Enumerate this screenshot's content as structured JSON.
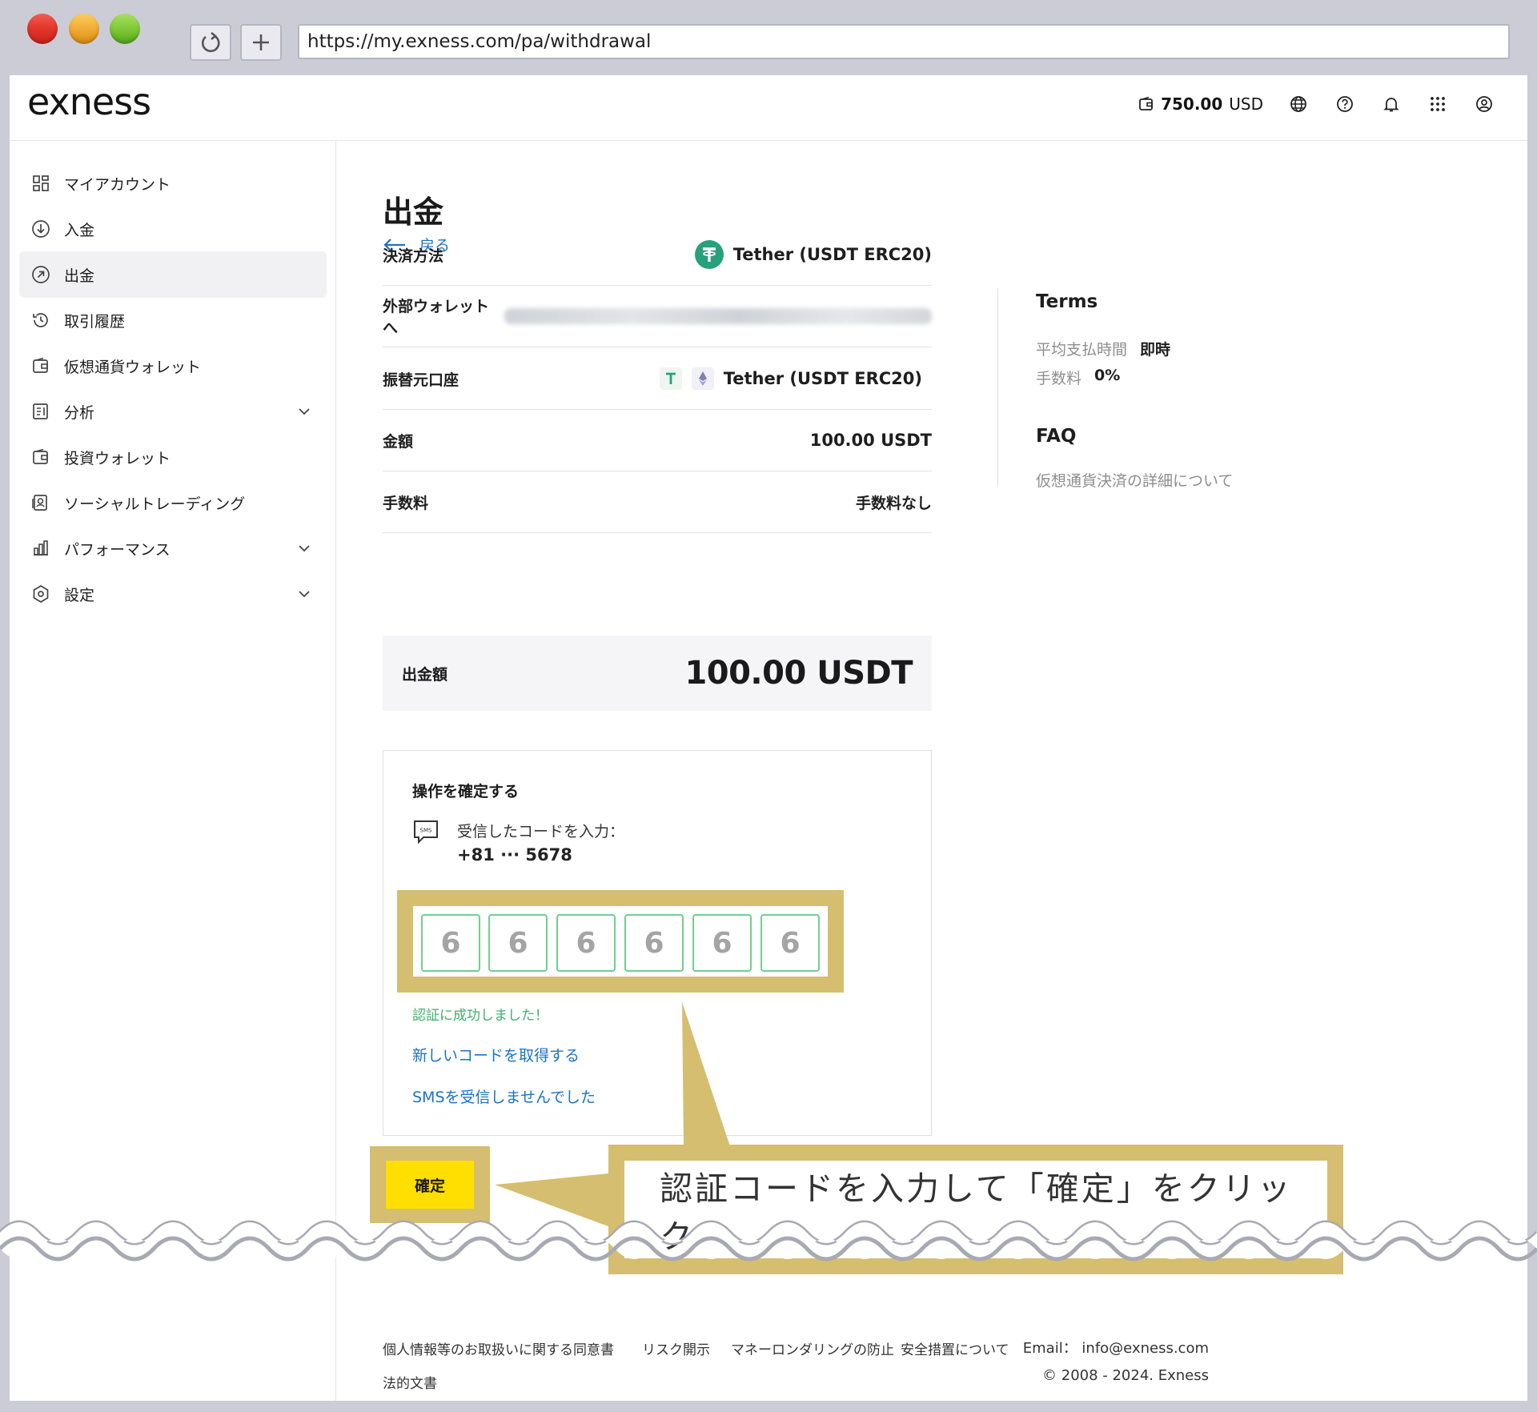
{
  "browser": {
    "url": "https://my.exness.com/pa/withdrawal"
  },
  "header": {
    "logo": "exness",
    "balance_amount": "750.00",
    "balance_currency": "USD"
  },
  "sidebar": {
    "items": [
      {
        "label": "マイアカウント",
        "icon": "dashboard-icon"
      },
      {
        "label": "入金",
        "icon": "deposit-icon"
      },
      {
        "label": "出金",
        "icon": "withdraw-icon",
        "active": true
      },
      {
        "label": "取引履歴",
        "icon": "history-icon"
      },
      {
        "label": "仮想通貨ウォレット",
        "icon": "wallet-icon"
      },
      {
        "label": "分析",
        "icon": "analytics-icon",
        "expandable": true
      },
      {
        "label": "投資ウォレット",
        "icon": "wallet-icon"
      },
      {
        "label": "ソーシャルトレーディング",
        "icon": "social-icon"
      },
      {
        "label": "パフォーマンス",
        "icon": "bar-chart-icon",
        "expandable": true
      },
      {
        "label": "設定",
        "icon": "settings-icon",
        "expandable": true
      }
    ]
  },
  "main": {
    "title": "出金",
    "back_label": "戻る",
    "rows": [
      {
        "label": "決済方法",
        "value": "Tether (USDT ERC20)"
      },
      {
        "label": "外部ウォレットへ",
        "value": ""
      },
      {
        "label": "振替元口座",
        "value": "Tether (USDT ERC20)"
      },
      {
        "label": "金額",
        "value": "100.00 USDT"
      },
      {
        "label": "手数料",
        "value": "手数料なし"
      }
    ],
    "total_label": "出金額",
    "total_amount": "100.00 USDT"
  },
  "confirm": {
    "title": "操作を確定する",
    "prompt": "受信したコードを入力：",
    "phone": "+81 ··· 5678",
    "code_digits": [
      "6",
      "6",
      "6",
      "6",
      "6",
      "6"
    ],
    "success": "認証に成功しました！",
    "new_code_link": "新しいコードを取得する",
    "no_sms_link": "SMSを受信しませんでした",
    "button_label": "確定"
  },
  "callout": {
    "text": "認証コードを入力して「確定」をクリック"
  },
  "side_panel": {
    "terms_title": "Terms",
    "avg_time_label": "平均支払時間",
    "avg_time_value": "即時",
    "fee_label": "手数料",
    "fee_value": "0%",
    "faq_title": "FAQ",
    "faq_link": "仮想通貨決済の詳細について"
  },
  "footer": {
    "links": [
      "個人情報等のお取扱いに関する同意書",
      "リスク開示",
      "マネーロンダリングの防止",
      "安全措置について",
      "法的文書"
    ],
    "email": "Email： info@exness.com",
    "copyright": "© 2008 - 2024. Exness"
  },
  "colors": {
    "accent": "#1a73c7",
    "confirm_button": "#ffde02",
    "highlight": "#d5be6f",
    "success": "#3fae6d"
  }
}
